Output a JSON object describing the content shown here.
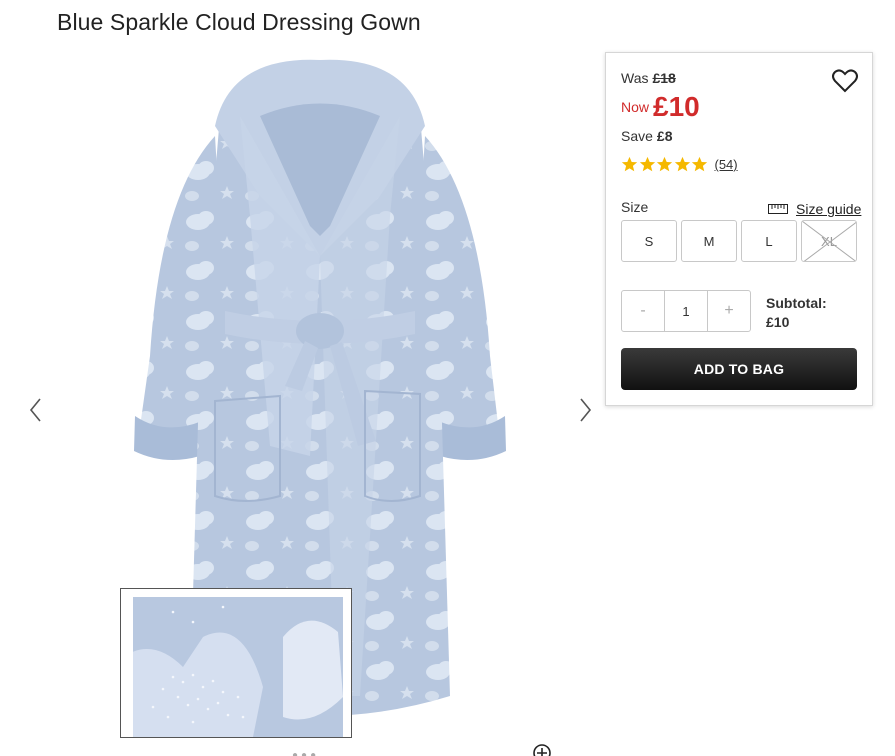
{
  "product": {
    "title": "Blue Sparkle Cloud Dressing Gown"
  },
  "gallery": {
    "prev_icon": "chevron-left-icon",
    "next_icon": "chevron-right-icon",
    "zoom_icon": "zoom-plus-icon",
    "dots": "●●●"
  },
  "price": {
    "was_label": "Was",
    "was_value": "£18",
    "now_label": "Now",
    "now_value": "£10",
    "save_label": "Save",
    "save_value": "£8",
    "now_color": "#d12b2b"
  },
  "rating": {
    "stars": 5,
    "count_text": "(54)",
    "star_color": "#f5b800"
  },
  "size": {
    "label": "Size",
    "guide_label": "Size guide",
    "guide_icon": "ruler-icon",
    "options": [
      "S",
      "M",
      "L",
      "XL"
    ],
    "unavailable": [
      "XL"
    ]
  },
  "quantity": {
    "minus": "-",
    "value": "1",
    "plus": "+"
  },
  "subtotal": {
    "label": "Subtotal:",
    "value": "£10"
  },
  "actions": {
    "add_to_bag": "ADD TO BAG",
    "wishlist_icon": "heart-icon"
  }
}
